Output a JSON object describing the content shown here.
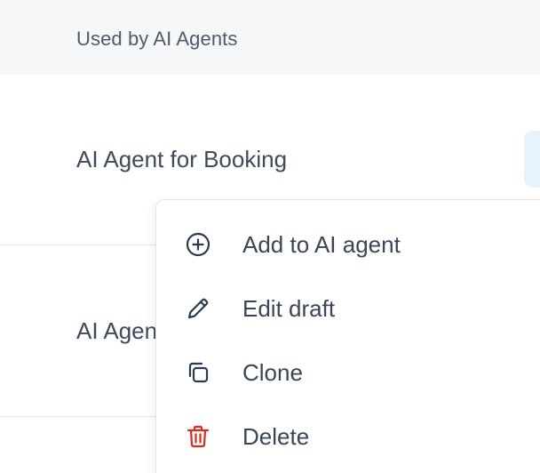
{
  "table": {
    "column_header": "Used by AI Agents",
    "rows": [
      {
        "label": "AI Agent for Booking"
      },
      {
        "label": "AI Agent"
      }
    ]
  },
  "menu": {
    "items": [
      {
        "label": "Add to AI agent",
        "icon": "plus-circle-icon"
      },
      {
        "label": "Edit draft",
        "icon": "pencil-icon"
      },
      {
        "label": "Clone",
        "icon": "copy-icon"
      },
      {
        "label": "Delete",
        "icon": "trash-icon"
      }
    ]
  },
  "colors": {
    "header_bg": "#f5f7f9",
    "text": "#3e4a5c",
    "icon": "#2c3a4f",
    "danger": "#d92d20",
    "chip": "#e7f2fd"
  }
}
